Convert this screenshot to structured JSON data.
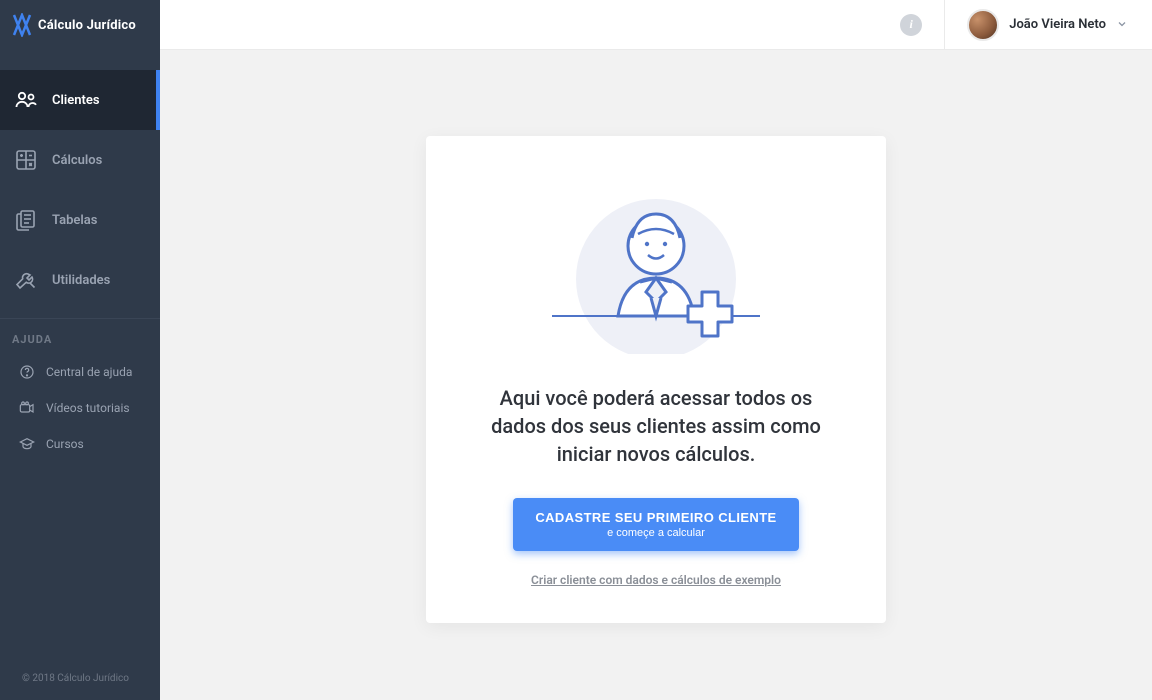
{
  "brand": {
    "name": "Cálculo Jurídico"
  },
  "sidebar": {
    "items": [
      {
        "label": "Clientes"
      },
      {
        "label": "Cálculos"
      },
      {
        "label": "Tabelas"
      },
      {
        "label": "Utilidades"
      }
    ],
    "help_section_title": "AJUDA",
    "help_items": [
      {
        "label": "Central de ajuda"
      },
      {
        "label": "Vídeos tutoriais"
      },
      {
        "label": "Cursos"
      }
    ],
    "copyright": "© 2018 Cálculo Jurídico"
  },
  "topbar": {
    "user_name": "João Vieira Neto"
  },
  "card": {
    "headline": "Aqui você poderá acessar todos os dados dos seus clientes assim como iniciar novos cálculos.",
    "cta_line1": "CADASTRE SEU PRIMEIRO CLIENTE",
    "cta_line2": "e começe a calcular",
    "example_link": "Criar cliente com dados e cálculos de exemplo"
  }
}
